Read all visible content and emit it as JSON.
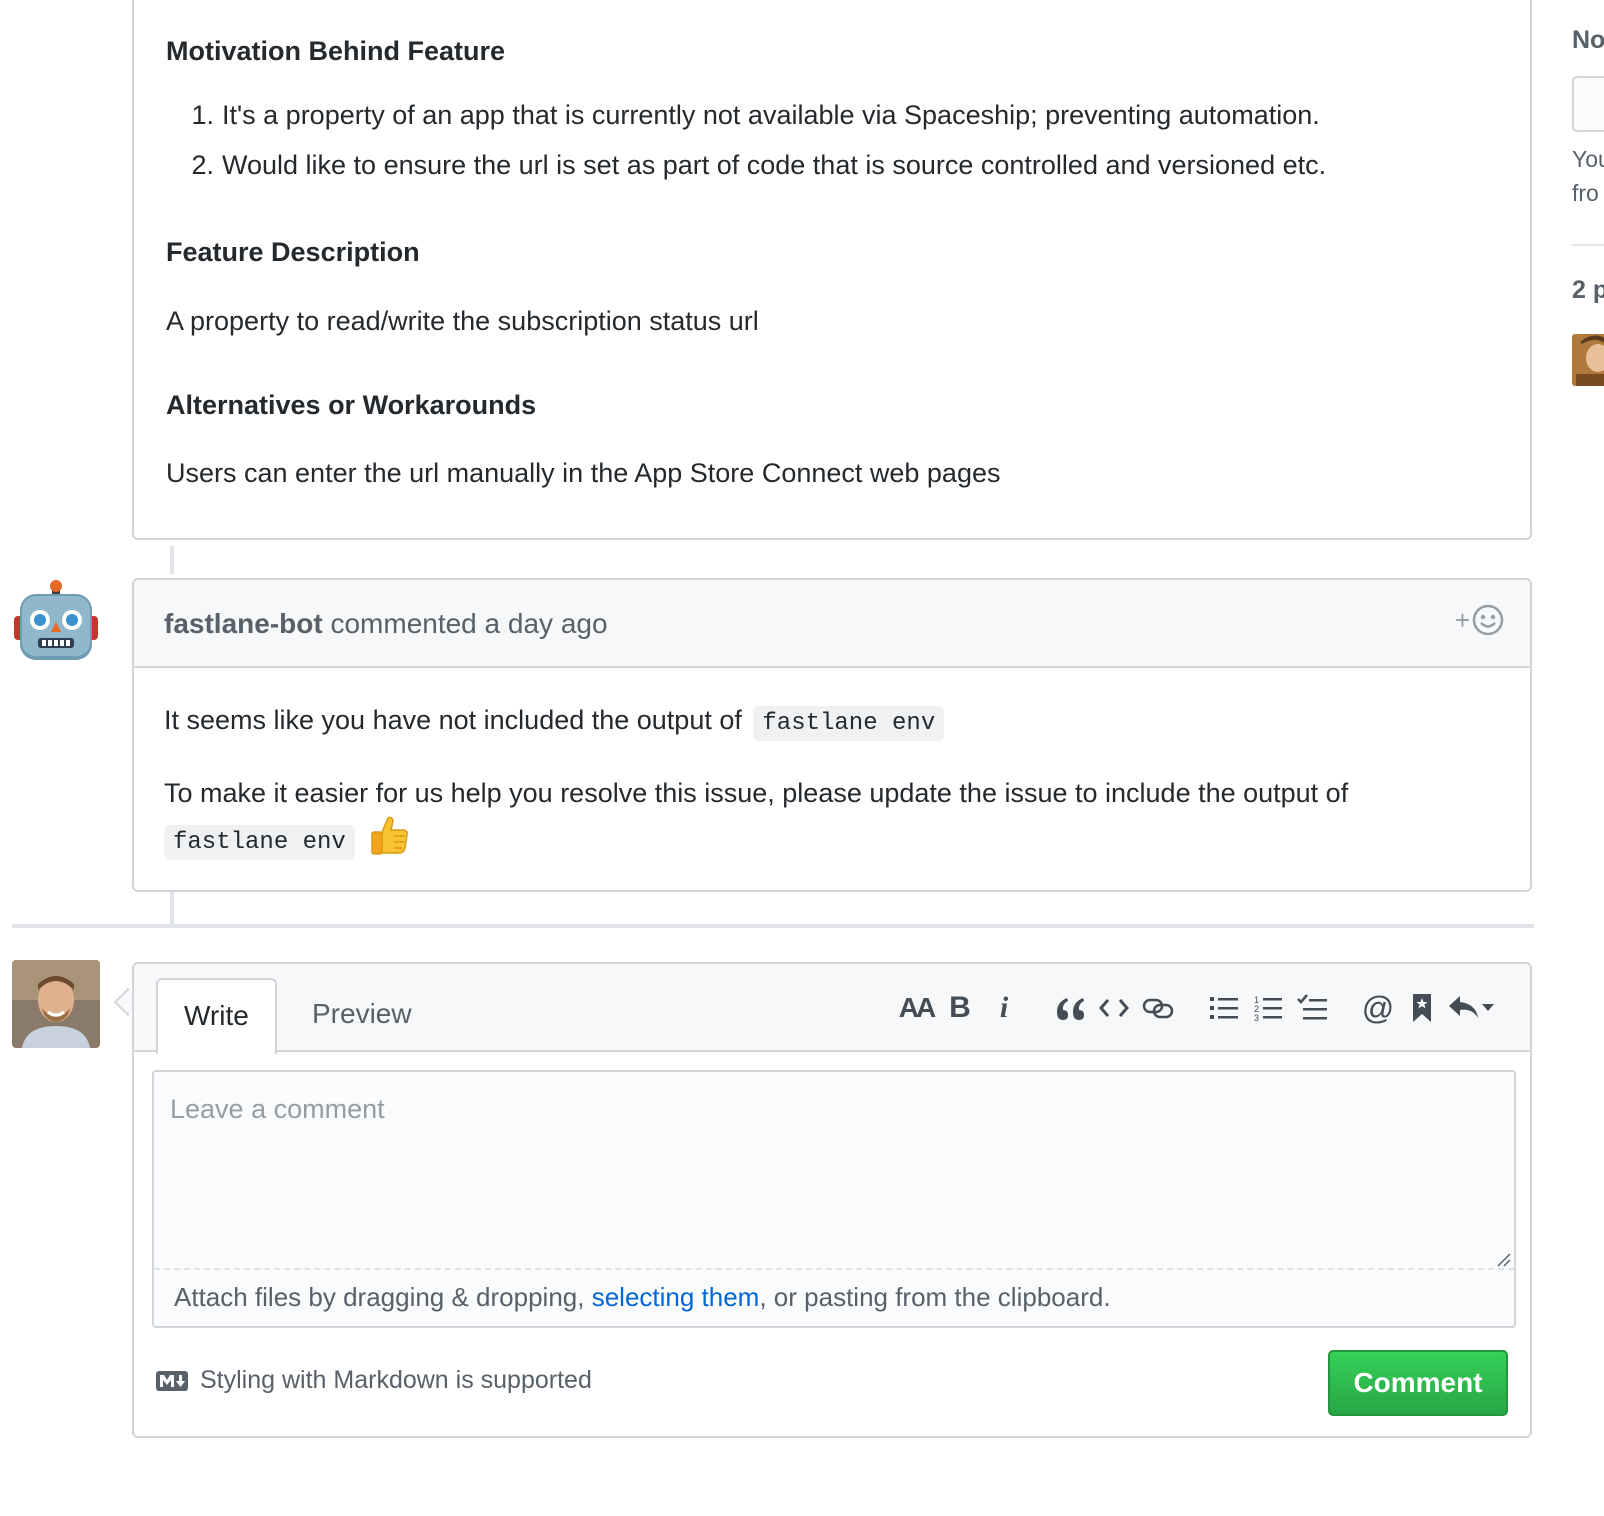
{
  "issue": {
    "sections": [
      {
        "heading": "Motivation Behind Feature"
      },
      {
        "heading": "Feature Description",
        "text": "A property to read/write the subscription status url"
      },
      {
        "heading": "Alternatives or Workarounds",
        "text": "Users can enter the url manually in the App Store Connect web pages"
      }
    ],
    "motivation_items": [
      {
        "num": "1.",
        "text": "It's a property of an app that is currently not available via Spaceship; preventing automation."
      },
      {
        "num": "2.",
        "text": "Would like to ensure the url is set as part of code that is source controlled and versioned etc."
      }
    ]
  },
  "bot_comment": {
    "author": "fastlane-bot",
    "meta": "commented a day ago",
    "reaction_plus": "+",
    "line1_text": "It seems like you have not included the output of",
    "line1_code": "fastlane env",
    "line2_text": "To make it easier for us help you resolve this issue, please update the issue to include the output of",
    "line2_code": "fastlane env"
  },
  "form": {
    "tabs": {
      "write": "Write",
      "preview": "Preview"
    },
    "toolbar": {
      "header": "AA",
      "bold": "B",
      "italic": "i",
      "mention": "@"
    },
    "placeholder": "Leave a comment",
    "attach_prefix": "Attach files by dragging & dropping, ",
    "attach_link": "selecting them",
    "attach_suffix": ", or pasting from the clipboard.",
    "markdown_hint": "Styling with Markdown is supported",
    "submit_label": "Comment"
  },
  "sidebar": {
    "title": "No",
    "text_line1": "You",
    "text_line2": "fro",
    "participants": "2 p"
  },
  "colors": {
    "accent_green": "#28a745",
    "link_blue": "#0366d6",
    "border": "#d1d5da"
  }
}
